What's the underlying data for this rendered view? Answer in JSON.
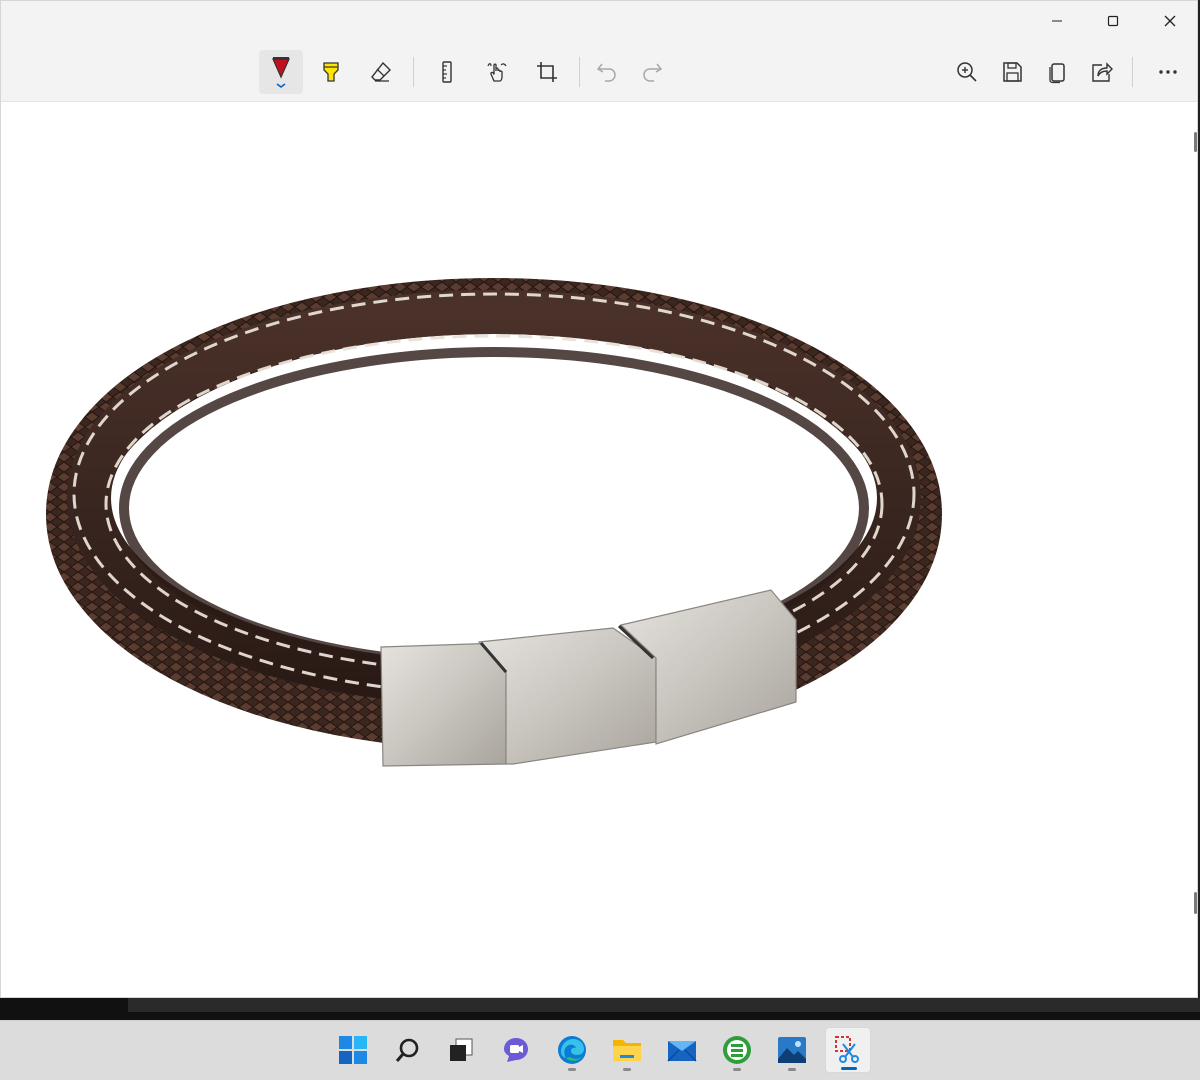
{
  "window": {
    "caption_buttons": [
      {
        "name": "minimize-button",
        "icon": "minimize-icon"
      },
      {
        "name": "maximize-button",
        "icon": "maximize-icon"
      },
      {
        "name": "close-button",
        "icon": "close-icon"
      }
    ]
  },
  "toolbar": {
    "tools": [
      {
        "name": "ballpoint-pen-tool",
        "icon": "pen-icon",
        "active": true,
        "color": "#c50f1f"
      },
      {
        "name": "highlighter-tool",
        "icon": "highlighter-icon",
        "color": "#ffe600"
      },
      {
        "name": "eraser-tool",
        "icon": "eraser-icon"
      },
      {
        "name": "ruler-tool",
        "icon": "ruler-icon"
      },
      {
        "name": "touch-writing-tool",
        "icon": "touch-writing-icon"
      },
      {
        "name": "crop-tool",
        "icon": "crop-icon"
      },
      {
        "name": "undo-button",
        "icon": "undo-icon",
        "disabled": true
      },
      {
        "name": "redo-button",
        "icon": "redo-icon",
        "disabled": true
      }
    ],
    "actions": [
      {
        "name": "zoom-button",
        "icon": "zoom-in-icon"
      },
      {
        "name": "save-button",
        "icon": "save-icon"
      },
      {
        "name": "copy-button",
        "icon": "copy-icon"
      },
      {
        "name": "share-button",
        "icon": "share-icon"
      },
      {
        "name": "more-button",
        "icon": "more-icon"
      }
    ]
  },
  "canvas": {
    "image": "leather-bracelet-image",
    "leather_color": "#3e2a23",
    "stitch_color": "#e8e0d6",
    "clasp_color": "#c9c5bf"
  },
  "taskbar": {
    "items": [
      {
        "name": "start-button",
        "icon": "windows-logo-icon"
      },
      {
        "name": "search-button",
        "icon": "search-icon"
      },
      {
        "name": "task-view-button",
        "icon": "task-view-icon"
      },
      {
        "name": "chat-button",
        "icon": "chat-icon"
      },
      {
        "name": "edge-button",
        "icon": "edge-icon",
        "running": true
      },
      {
        "name": "file-explorer-button",
        "icon": "folder-icon",
        "running": true
      },
      {
        "name": "mail-button",
        "icon": "mail-icon"
      },
      {
        "name": "green-app-button",
        "icon": "green-app-icon",
        "running": true
      },
      {
        "name": "photos-button",
        "icon": "photos-icon",
        "running": true
      },
      {
        "name": "snipping-tool-button",
        "icon": "snipping-tool-icon",
        "running": true,
        "active": true
      }
    ]
  }
}
